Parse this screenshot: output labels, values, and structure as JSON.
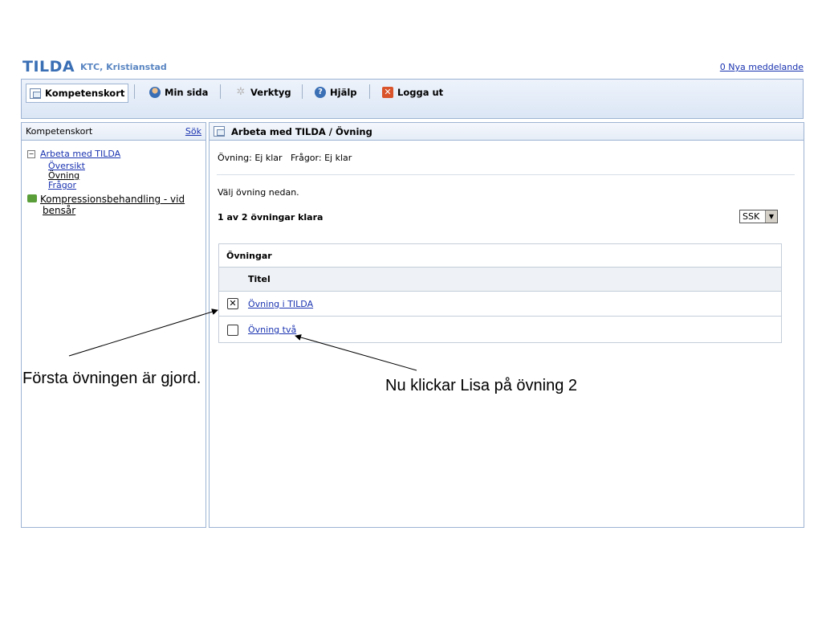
{
  "header": {
    "logo": "TILDA",
    "org": "KTC, Kristianstad",
    "messages_link": "0 Nya meddelande"
  },
  "toolbar": {
    "items": [
      {
        "label": "Kompetenskort",
        "icon": "document-icon"
      },
      {
        "label": "Min sida",
        "icon": "user-icon"
      },
      {
        "label": "Verktyg",
        "icon": "gear-icon"
      },
      {
        "label": "Hjälp",
        "icon": "help-icon"
      },
      {
        "label": "Logga ut",
        "icon": "logout-icon"
      }
    ]
  },
  "left_panel": {
    "title": "Kompetenskort",
    "search_link": "Sök",
    "tree": {
      "root": {
        "toggle": "−",
        "label": "Arbeta med TILDA"
      },
      "children": [
        "Översikt",
        "Övning",
        "Frågor"
      ],
      "sibling": {
        "label_line1": "Kompressionsbehandling - vid",
        "label_line2": "bensår"
      }
    }
  },
  "main": {
    "breadcrumb": "Arbeta med TILDA / Övning",
    "status": "Övning: Ej klar   Frågor: Ej klar",
    "instruction": "Välj övning nedan.",
    "progress": "1 av 2 övningar klara",
    "select_value": "SSK",
    "table": {
      "caption": "Övningar",
      "column": "Titel",
      "rows": [
        {
          "title": "Övning i TILDA",
          "checkbox_mark": "✕"
        },
        {
          "title": "Övning två",
          "checkbox_mark": ""
        }
      ]
    }
  },
  "annotations": {
    "left": "Första övningen är gjord.",
    "right": "Nu klickar Lisa på övning 2"
  }
}
